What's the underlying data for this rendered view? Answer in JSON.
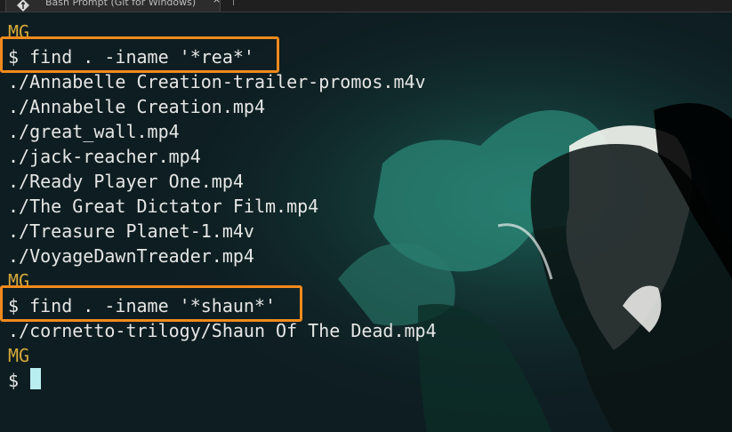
{
  "window": {
    "tab_title": "Bash Prompt (Git for Windows)",
    "tab_icon": "git-bash-icon",
    "close_glyph": "×"
  },
  "terminal": {
    "colors": {
      "user": "#d4a93a",
      "text": "#e6e6e6",
      "highlight": "#f08a1c",
      "cursor": "#b9eef0",
      "background": "#0e1d21"
    },
    "blocks": [
      {
        "user": "MG",
        "command": "$ find . -iname '*rea*'",
        "highlighted": true,
        "output": [
          "./Annabelle Creation-trailer-promos.m4v",
          "./Annabelle Creation.mp4",
          "./great_wall.mp4",
          "./jack-reacher.mp4",
          "./Ready Player One.mp4",
          "./The Great Dictator Film.mp4",
          "./Treasure Planet-1.m4v",
          "./VoyageDawnTreader.mp4"
        ]
      },
      {
        "user": "MG",
        "command": "$ find . -iname '*shaun*'",
        "highlighted": true,
        "output": [
          "./cornetto-trilogy/Shaun Of The Dead.mp4"
        ]
      }
    ],
    "final_user": "MG",
    "final_prompt": "$"
  }
}
